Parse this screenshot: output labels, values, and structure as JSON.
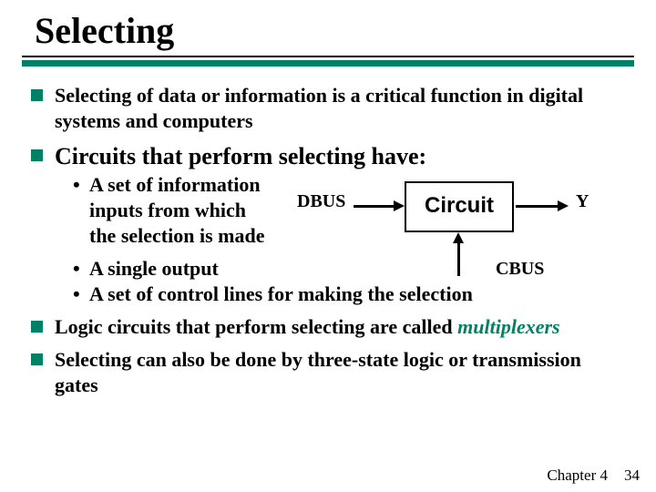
{
  "title": "Selecting",
  "bullets": {
    "b1": "Selecting of data or information is a critical function in digital systems and computers",
    "b2": "Circuits that perform selecting have:",
    "sub1": "A set of information inputs from which the selection is made",
    "sub2": "A single output",
    "sub3": "A set of control lines for making the selection",
    "b3_pre": "Logic circuits that perform selecting are called ",
    "b3_em": "multiplexers",
    "b4": "Selecting can also be done by three-state logic or transmission gates"
  },
  "diagram": {
    "box": "Circuit",
    "dbus": "DBUS",
    "cbus": "CBUS",
    "y": "Y"
  },
  "footer": {
    "chapter": "Chapter 4",
    "page": "34"
  }
}
